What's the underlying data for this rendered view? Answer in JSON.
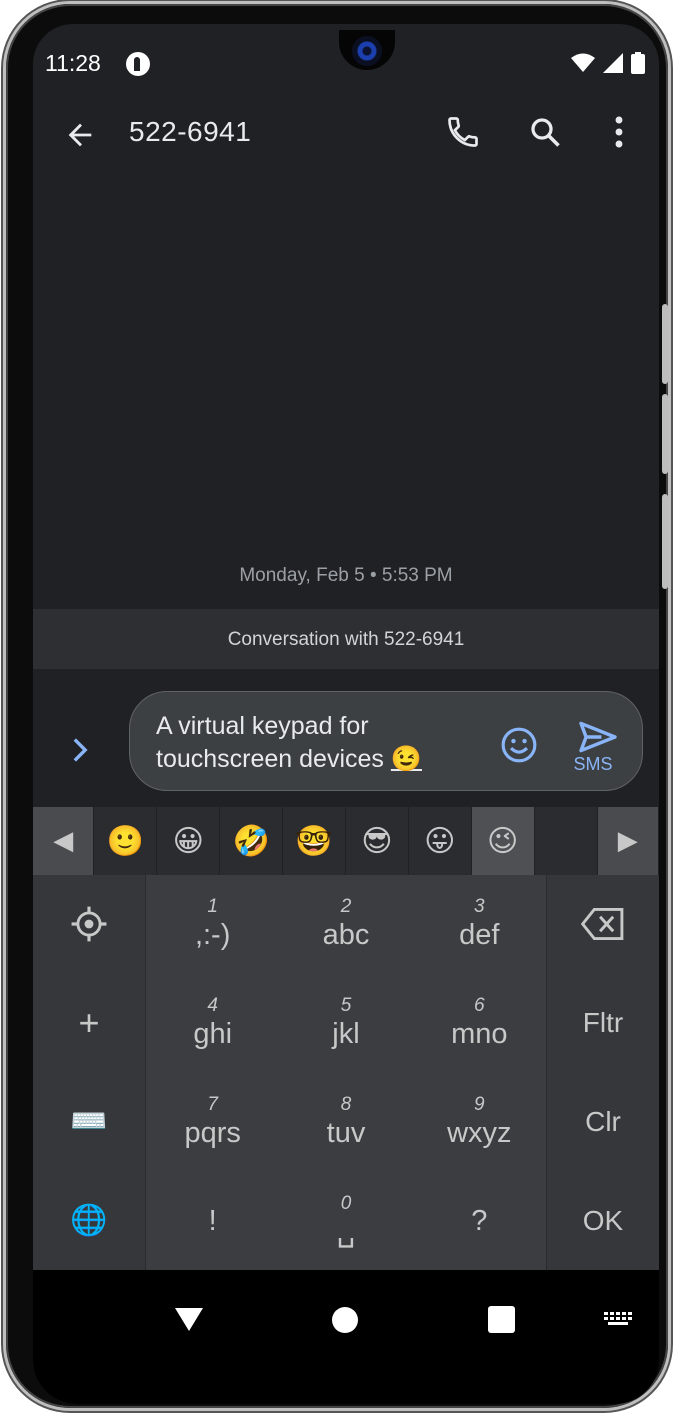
{
  "status_bar": {
    "time": "11:28"
  },
  "app_bar": {
    "title": "522-6941"
  },
  "conversation": {
    "date_label": "Monday, Feb 5 • 5:53 PM",
    "banner": "Conversation with 522-6941"
  },
  "compose": {
    "message_line1": "A virtual keypad for",
    "message_line2": "touchscreen devices",
    "message_emoji": "😉",
    "send_label": "SMS"
  },
  "emoji_bar": {
    "left_arrow": "◀",
    "right_arrow": "▶",
    "items": [
      "🙂",
      "😀",
      "🤣",
      "🤓",
      "😎",
      "😛",
      "😉",
      ""
    ]
  },
  "keypad": {
    "left_keys": [
      "settings-icon",
      "plus-icon",
      "keyboard-icon",
      "globe-icon"
    ],
    "left_glyphs": {
      "plus": "+",
      "keyboard": "⌨️",
      "globe": "🌐"
    },
    "keys": [
      {
        "num": "1",
        "letters": ",:-)"
      },
      {
        "num": "2",
        "letters": "abc"
      },
      {
        "num": "3",
        "letters": "def"
      },
      {
        "num": "4",
        "letters": "ghi"
      },
      {
        "num": "5",
        "letters": "jkl"
      },
      {
        "num": "6",
        "letters": "mno"
      },
      {
        "num": "7",
        "letters": "pqrs"
      },
      {
        "num": "8",
        "letters": "tuv"
      },
      {
        "num": "9",
        "letters": "wxyz"
      },
      {
        "num": "",
        "letters": "!"
      },
      {
        "num": "0",
        "letters": "␣"
      },
      {
        "num": "",
        "letters": "?"
      }
    ],
    "right_keys": {
      "fltr": "Fltr",
      "clr": "Clr",
      "ok": "OK"
    }
  },
  "colors": {
    "background": "#202124",
    "accent": "#8ab4f8",
    "key_text": "#c8c8c8"
  }
}
